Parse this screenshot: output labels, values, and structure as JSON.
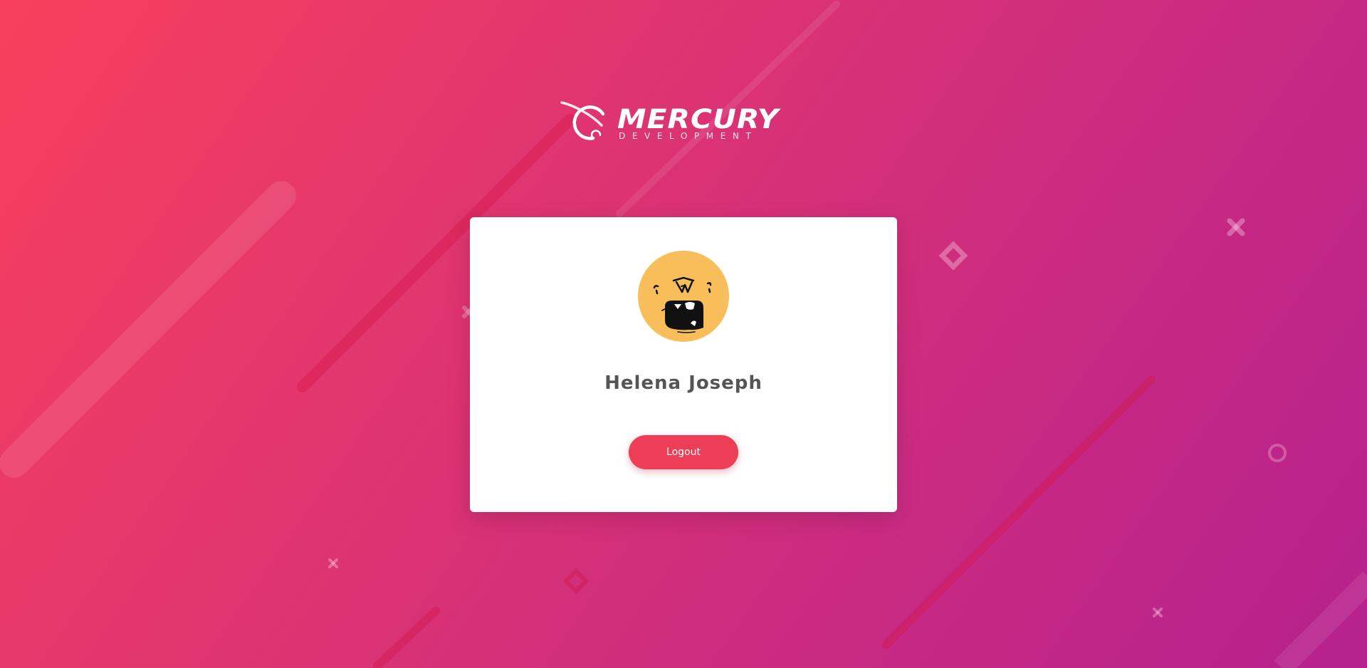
{
  "brand": {
    "title": "MERCURY",
    "subtitle": "DEVELOPMENT"
  },
  "profile": {
    "avatar_icon": "monster-face-icon",
    "name": "Helena Joseph"
  },
  "actions": {
    "logout_label": "Logout"
  },
  "colors": {
    "background_start": "#f8405c",
    "background_end": "#b5218d",
    "card": "#ffffff",
    "avatar": "#f7be59",
    "button": "#ee3e57",
    "name_text": "#555558"
  }
}
